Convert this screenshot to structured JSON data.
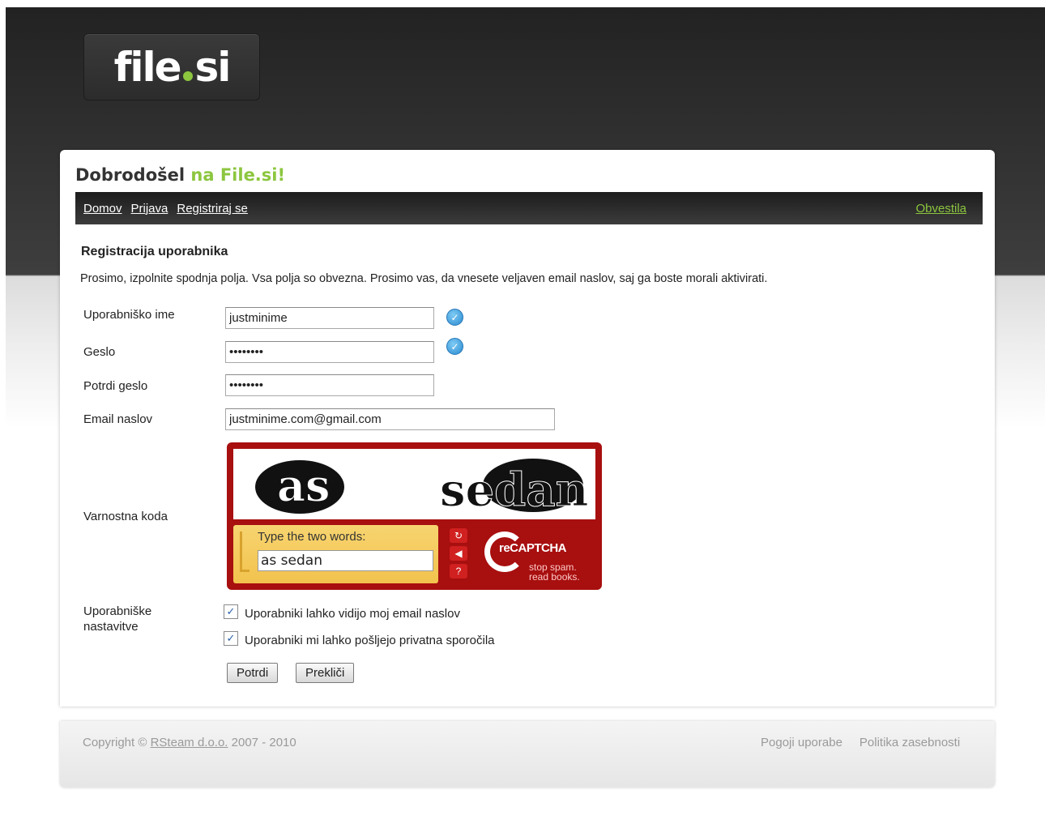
{
  "logo": {
    "left": "file",
    "right": "si"
  },
  "header": {
    "welcome_prefix": "Dobrodošel",
    "welcome_suffix": "na File.si!"
  },
  "nav": {
    "links": [
      "Domov",
      "Prijava",
      "Registriraj se"
    ],
    "right": "Obvestila"
  },
  "form": {
    "title": "Registracija uporabnika",
    "intro": "Prosimo, izpolnite spodnja polja. Vsa polja so obvezna. Prosimo vas, da vnesete veljaven email naslov, saj ga boste morali aktivirati.",
    "username": {
      "label": "Uporabniško ime",
      "value": "justminime"
    },
    "password": {
      "label": "Geslo",
      "value": "••••••••"
    },
    "confirm": {
      "label": "Potrdi geslo",
      "value": "••••••••"
    },
    "email": {
      "label": "Email naslov",
      "value": "justminime.com@gmail.com"
    },
    "captcha": {
      "label": "Varnostna koda",
      "prompt": "Type the two words:",
      "value": "as sedan",
      "brand": "reCAPTCHA",
      "tagline1": "stop spam.",
      "tagline2": "read books.",
      "word1": "as",
      "word2": "sedan"
    },
    "settings": {
      "label_line1": "Uporabniške",
      "label_line2": "nastavitve",
      "option1": "Uporabniki lahko vidijo moj email naslov",
      "option2": "Uporabniki mi lahko pošljejo privatna sporočila",
      "option1_checked": true,
      "option2_checked": true
    },
    "submit": "Potrdi",
    "cancel": "Prekliči"
  },
  "footer": {
    "copyright_prefix": "Copyright ©",
    "company": "RSteam d.o.o.",
    "years": "2007 - 2010",
    "links": [
      "Pogoji uporabe",
      "Politika zasebnosti"
    ]
  },
  "colors": {
    "accent": "#8cc63f",
    "captcha_red": "#a80f0f",
    "captcha_yellow": "#f2c24d"
  }
}
